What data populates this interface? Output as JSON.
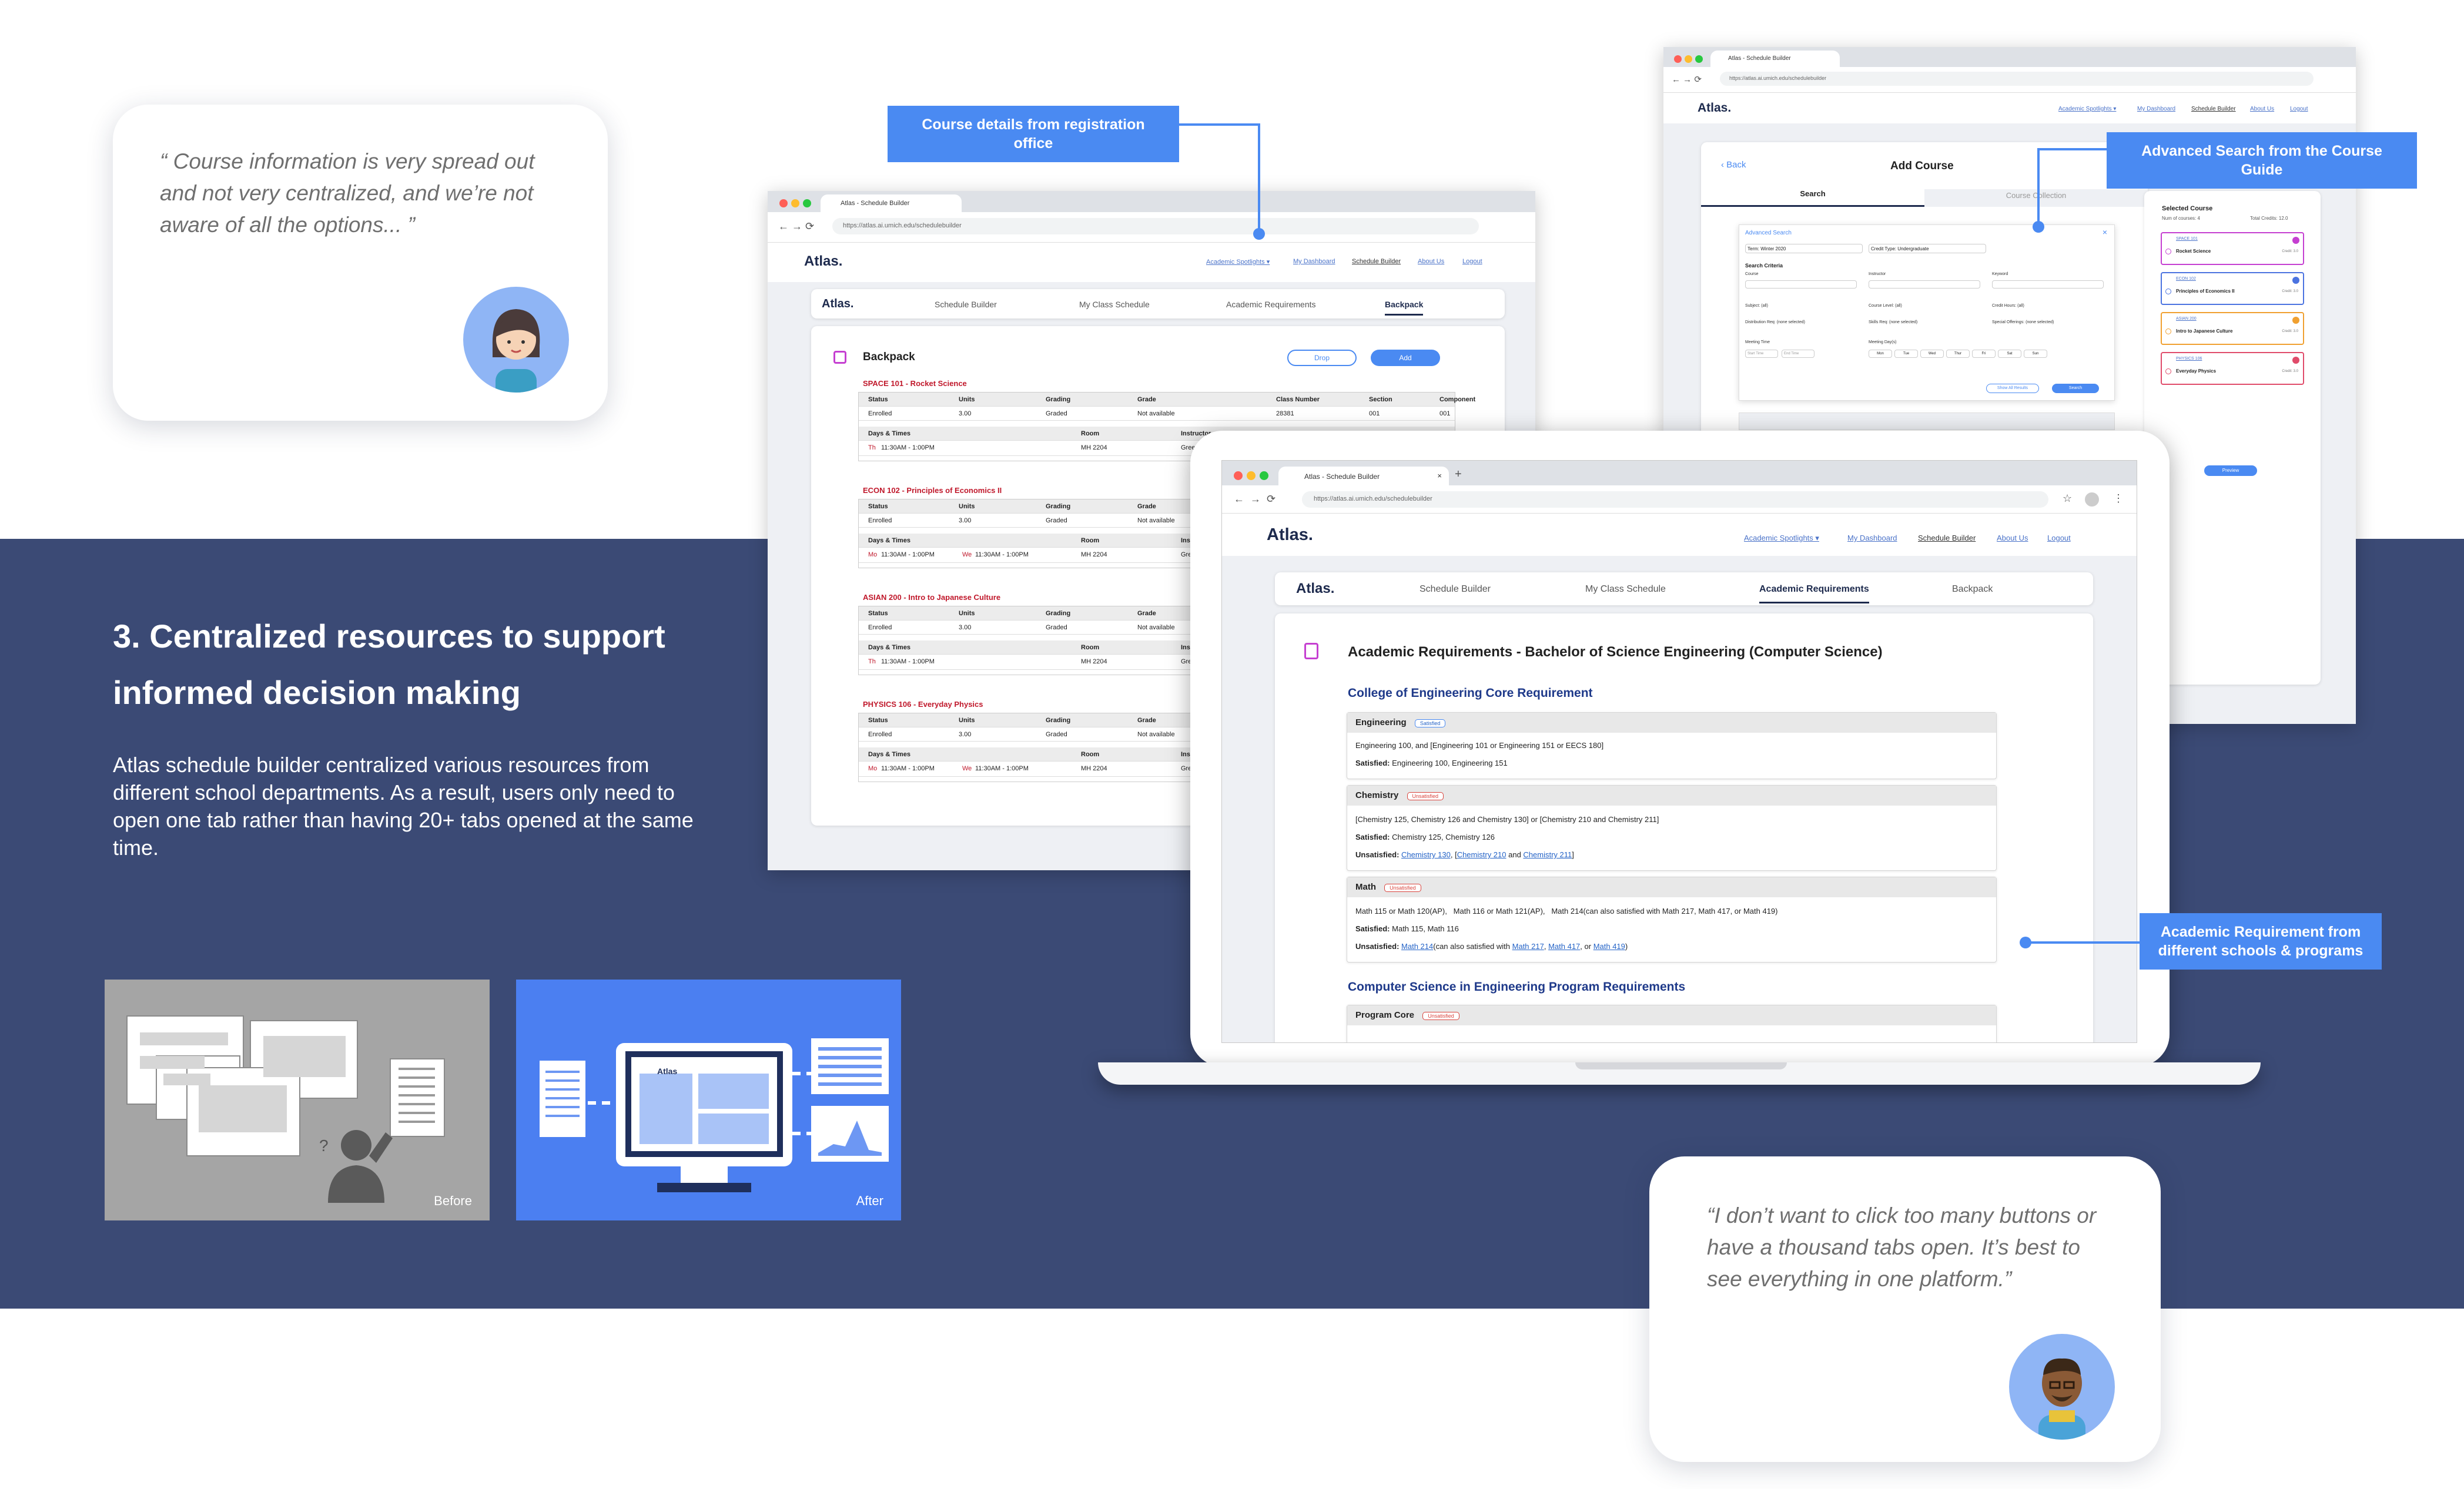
{
  "quote_top": {
    "text": "“ Course information is very spread out and not very centralized, and we’re not aware of all the options... ”"
  },
  "quote_bottom": {
    "text": "“I don’t want to click too many buttons or have a thousand tabs open. It’s best to see everything in one platform.”"
  },
  "section": {
    "heading": "3. Centralized resources to support informed decision making",
    "body": "Atlas schedule builder centralized various resources from different school departments. As a result, users only need to open one tab rather than having 20+ tabs opened at the same time."
  },
  "illustrations": {
    "before_label": "Before",
    "after_label": "After",
    "after_window_logo": "Atlas"
  },
  "callouts": {
    "course_details": "Course details from registration office",
    "advanced_search": "Advanced Search from the Course Guide",
    "academic_req": "Academic Requirement from different schools & programs"
  },
  "browser": {
    "tab_title": "Atlas - Schedule Builder",
    "url": "https://atlas.ai.umich.edu/schedulebuilder",
    "logo": "Atlas.",
    "nav": [
      "Academic Spotlights ▾",
      "My Dashboard",
      "Schedule Builder",
      "About Us",
      "Logout"
    ],
    "subnav": [
      "Schedule Builder",
      "My Class Schedule",
      "Academic Requirements",
      "Backpack"
    ]
  },
  "backpack": {
    "title": "Backpack",
    "drop": "Drop",
    "add": "Add",
    "cols": [
      "Status",
      "Units",
      "Grading",
      "Grade",
      "Class Number",
      "Section",
      "Component"
    ],
    "sub_cols": [
      "Days & Times",
      "Room",
      "Instructor"
    ],
    "courses": [
      {
        "title": "SPACE 101 - Rocket Science",
        "status": "Enrolled",
        "units": "3.00",
        "grading": "Graded",
        "grade": "Not available",
        "class_no": "28381",
        "section": "001",
        "component": "001",
        "day1": "Th",
        "time1": "11:30AM - 1:00PM",
        "day2": "",
        "time2": "",
        "room": "MH 2204",
        "instr": "Green"
      },
      {
        "title": "ECON 102 - Principles of Economics II",
        "status": "Enrolled",
        "units": "3.00",
        "grading": "Graded",
        "grade": "Not available",
        "day1": "Mo",
        "time1": "11:30AM - 1:00PM",
        "day2": "We",
        "time2": "11:30AM - 1:00PM",
        "room": "MH 2204",
        "instr": "Green"
      },
      {
        "title": "ASIAN 200 - Intro to Japanese Culture",
        "status": "Enrolled",
        "units": "3.00",
        "grading": "Graded",
        "grade": "Not available",
        "day1": "Th",
        "time1": "11:30AM - 1:00PM",
        "day2": "",
        "time2": "",
        "room": "MH 2204",
        "instr": "Green"
      },
      {
        "title": "PHYSICS 106 - Everyday Physics",
        "status": "Enrolled",
        "units": "3.00",
        "grading": "Graded",
        "grade": "Not available",
        "day1": "Mo",
        "time1": "11:30AM - 1:00PM",
        "day2": "We",
        "time2": "11:30AM - 1:00PM",
        "room": "MH 2204",
        "instr": "Green"
      }
    ]
  },
  "add_course": {
    "back": "Back",
    "title": "Add Course",
    "tab_search": "Search",
    "tab_collection": "Course Collection",
    "adv_title": "Advanced Search",
    "term": "Term: Winter 2020",
    "credit_type": "Credit Type: Undergraduate",
    "criteria": "Search Criteria",
    "labels": [
      "Course",
      "Instructor",
      "Keyword",
      "Subject: (all)",
      "Course Level: (all)",
      "Credit Hours: (all)",
      "Distribution Req: (none selected)",
      "Skills Req: (none selected)",
      "Special Offerings: (none selected)",
      "Meeting Time",
      "Meeting Day(s)"
    ],
    "start_time": "Start Time",
    "end_time": "End Time",
    "days": [
      "Mon",
      "Tue",
      "Wed",
      "Thur",
      "Fri",
      "Sat",
      "Sun"
    ],
    "more": "Show All Results",
    "search": "Search",
    "selected_title": "Selected Course",
    "num_courses": "Num of courses: 4",
    "total_credits": "Total Credits: 12.0",
    "selected": [
      {
        "code": "SPACE 101",
        "name": "Rocket Science",
        "credit": "Credit: 3.0",
        "color": "#c53fd1"
      },
      {
        "code": "ECON 102",
        "name": "Principles of Economics II",
        "credit": "Credit: 3.0",
        "color": "#4b73e0"
      },
      {
        "code": "ASIAN 200",
        "name": "Intro to Japanese Culture",
        "credit": "Credit: 3.0",
        "color": "#f0a030"
      },
      {
        "code": "PHYSICS 106",
        "name": "Everyday Physics",
        "credit": "Credit: 3.0",
        "color": "#e04b6a"
      }
    ],
    "preview": "Preview"
  },
  "academic": {
    "title": "Academic Requirements - Bachelor of Science Engineering (Computer Science)",
    "section1": "College of Engineering Core Requirement",
    "section2": "Computer Science in Engineering Program Requirements",
    "satisfied_label": "Satisfied:",
    "unsatisfied_label": "Unsatisfied:",
    "engineering": {
      "name": "Engineering",
      "badge": "Satisfied",
      "req": "Engineering 100, and [Engineering 101 or Engineering 151 or EECS 180]",
      "sat": "Engineering 100, Engineering 151"
    },
    "chemistry": {
      "name": "Chemistry",
      "badge": "Unsatisfied",
      "req": "[Chemistry 125, Chemistry 126 and Chemistry 130] or [Chemistry 210 and Chemistry 211]",
      "sat": "Chemistry 125, Chemistry 126",
      "unsat_1": "Chemistry 130",
      "unsat_sep1": ", [",
      "unsat_2": "Chemistry 210",
      "unsat_sep2": " and ",
      "unsat_3": "Chemistry 211",
      "unsat_end": "]"
    },
    "math": {
      "name": "Math",
      "badge": "Unsatisfied",
      "req": "Math 115 or Math 120(AP),   Math 116 or Math 121(AP),   Math 214(can also satisfied with Math 217, Math 417, or Math 419)",
      "sat": "Math 115, Math 116",
      "unsat_1": "Math 214",
      "unsat_mid": "(can also satisfied with ",
      "unsat_2": "Math 217",
      "unsat_3": "Math 417",
      "unsat_4": "Math 419",
      "unsat_or": ", or ",
      "unsat_end": ")"
    },
    "program_core": {
      "name": "Program Core",
      "badge": "Unsatisfied"
    }
  },
  "colors": {
    "band": "#3b4a75",
    "accent": "#4a8af2",
    "course_red": "#c0182b"
  }
}
